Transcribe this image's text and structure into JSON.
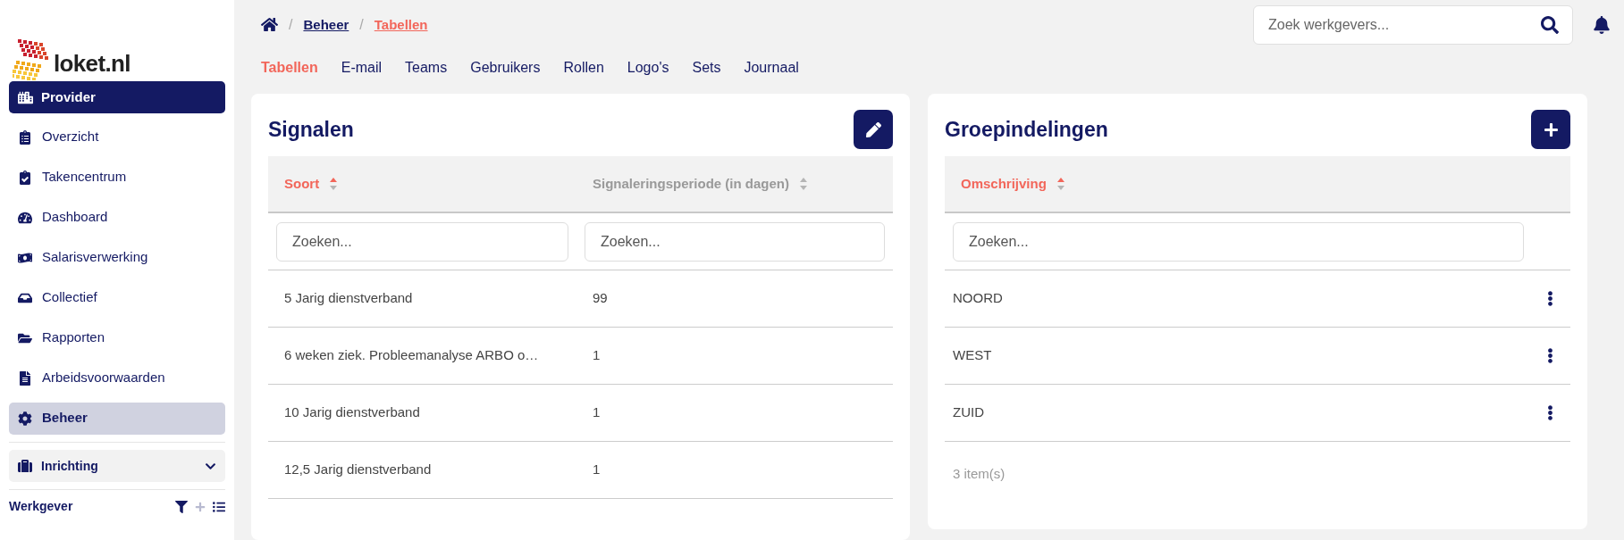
{
  "logo": {
    "text": "loket.nl"
  },
  "sidebar": {
    "context": {
      "label": "Provider"
    },
    "items": [
      {
        "label": "Overzicht",
        "selected": false
      },
      {
        "label": "Takencentrum",
        "selected": false
      },
      {
        "label": "Dashboard",
        "selected": false
      },
      {
        "label": "Salarisverwerking",
        "selected": false
      },
      {
        "label": "Collectief",
        "selected": false
      },
      {
        "label": "Rapporten",
        "selected": false
      },
      {
        "label": "Arbeidsvoorwaarden",
        "selected": false
      },
      {
        "label": "Beheer",
        "selected": true
      }
    ],
    "section": {
      "label": "Inrichting",
      "expanded": false
    },
    "footer": {
      "label": "Werkgever"
    }
  },
  "breadcrumb": [
    {
      "separator": "/",
      "label": "Beheer",
      "current": false
    },
    {
      "separator": "/",
      "label": "Tabellen",
      "current": true
    }
  ],
  "search": {
    "placeholder": "Zoek werkgevers..."
  },
  "tabs": [
    {
      "label": "Tabellen",
      "selected": true
    },
    {
      "label": "E-mail",
      "selected": false
    },
    {
      "label": "Teams",
      "selected": false
    },
    {
      "label": "Gebruikers",
      "selected": false
    },
    {
      "label": "Rollen",
      "selected": false
    },
    {
      "label": "Logo's",
      "selected": false
    },
    {
      "label": "Sets",
      "selected": false
    },
    {
      "label": "Journaal",
      "selected": false
    }
  ],
  "signalen": {
    "title": "Signalen",
    "columns": [
      {
        "label": "Soort",
        "sorted": true,
        "placeholder": "Zoeken..."
      },
      {
        "label": "Signaleringsperiode (in dagen)",
        "sorted": false,
        "placeholder": "Zoeken..."
      }
    ],
    "rows": [
      [
        "5 Jarig dienstverband",
        "99"
      ],
      [
        "6 weken ziek. Probleemanalyse ARBO o…",
        "1"
      ],
      [
        "10 Jarig dienstverband",
        "1"
      ],
      [
        "12,5 Jarig dienstverband",
        "1"
      ]
    ]
  },
  "groepindelingen": {
    "title": "Groepindelingen",
    "columns": [
      {
        "label": "Omschrijving",
        "sorted": true,
        "placeholder": "Zoeken..."
      }
    ],
    "rows": [
      "NOORD",
      "WEST",
      "ZUID"
    ],
    "count": "3 item(s)"
  }
}
